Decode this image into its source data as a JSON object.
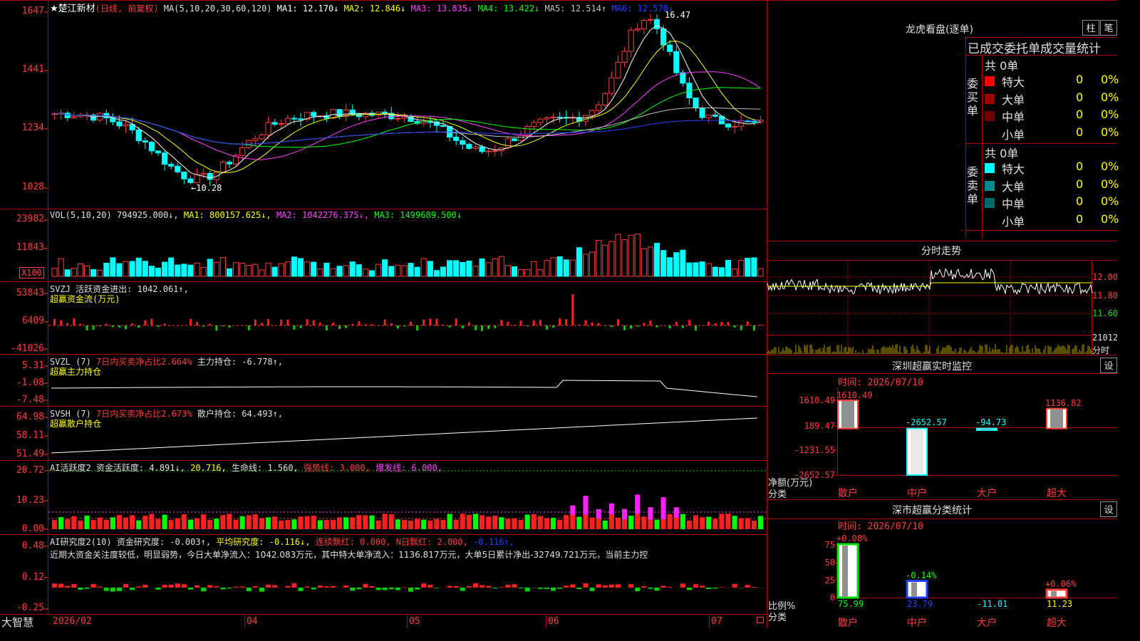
{
  "main_chart": {
    "stock_name": "★楚江新材",
    "period": "(日线, 前复权)",
    "ma_params": "MA(5,10,20,30,60,120)",
    "ma": [
      {
        "label": "MA1: 12.170↓",
        "color": "#ffffff"
      },
      {
        "label": "MA2: 12.846↓",
        "color": "#ffff00"
      },
      {
        "label": "MA3: 13.835↓",
        "color": "#ff40ff"
      },
      {
        "label": "MA4: 13.422↓",
        "color": "#00ff00"
      },
      {
        "label": "MA5: 12.514↑",
        "color": "#c0c0c0"
      },
      {
        "label": "MA6: 12.570↓",
        "color": "#2040ff"
      }
    ],
    "y_ticks": [
      "1647",
      "1441",
      "1234",
      "1028"
    ],
    "high_label": "16.47",
    "low_label": "←10.28"
  },
  "vol_panel": {
    "title": "VOL(5,10,20)",
    "value": "794925.000↓,",
    "ma1": "MA1: 800157.625↓,",
    "ma2": "MA2: 1042276.375↓,",
    "ma3": "MA3: 1499689.500↓",
    "y_ticks": [
      "23982",
      "11843"
    ],
    "unit": "X100"
  },
  "svzj_panel": {
    "title": "SVZJ",
    "label": "活跃资金进出: 1042.061↑,",
    "subtitle": "超赢资金流(万元)",
    "y_ticks": [
      "53843",
      "6409",
      "-41026"
    ]
  },
  "svzl_panel": {
    "title": "SVZL (7)",
    "ratio": "7日内买卖净占比2.664%",
    "label": "主力持仓: -6.778↑,",
    "subtitle": "超赢主力持仓",
    "y_ticks": [
      "5.31",
      "-1.08",
      "-7.48"
    ]
  },
  "svsh_panel": {
    "title": "SVSH (7)",
    "ratio": "7日内买卖净占比2.673%",
    "label": "散户持仓: 64.493↑,",
    "subtitle": "超赢散户持仓",
    "y_ticks": [
      "64.98",
      "58.11",
      "51.49"
    ]
  },
  "ai_active_panel": {
    "title": "AI活跃度2",
    "label": "资金活跃度: 4.891↓,",
    "v2": "20.716,",
    "life": "生命线: 1.560,",
    "strong": "强势线: 3.000,",
    "burst": "爆发线: 6.000,",
    "y_ticks": [
      "20.72",
      "10.23",
      "0.00"
    ]
  },
  "ai_research_panel": {
    "title": "AI研究度2(10)",
    "label": "资金研究度: -0.003↑,",
    "avg": "平均研究度: -0.116↓,",
    "red": "连续飘红: 0.000,",
    "nred": "N日飘红: 2.000,",
    "extra": "-0.116↑,",
    "comment": "近期大资金关注度较低，明显弱势，今日大单净流入：1042.083万元，其中特大单净流入：1136.817万元，大单5日累计净出-32749.721万元，当前主力控",
    "y_ticks": [
      "0.48",
      "0.12",
      "-0.25"
    ]
  },
  "x_axis": {
    "dates": [
      "2026/02",
      "04",
      "05",
      "06",
      "07"
    ],
    "brand": "大智慧"
  },
  "longhu": {
    "title": "龙虎看盘(逐单)",
    "tab_column": "柱",
    "tab_pen": "笔",
    "header": "已成交委托单成交量统计",
    "buy_label": "委买单",
    "sell_label": "委卖单",
    "buy_total": "共 0单",
    "sell_total": "共 0单",
    "buy_rows": [
      {
        "name": "特大",
        "count": "0",
        "pct": "0%",
        "color": "#ff0000"
      },
      {
        "name": "大单",
        "count": "0",
        "pct": "0%",
        "color": "#a00000"
      },
      {
        "name": "中单",
        "count": "0",
        "pct": "0%",
        "color": "#700000"
      },
      {
        "name": "小单",
        "count": "0",
        "pct": "0%",
        "color": ""
      }
    ],
    "sell_rows": [
      {
        "name": "特大",
        "count": "0",
        "pct": "0%",
        "color": "#00ffff"
      },
      {
        "name": "大单",
        "count": "0",
        "pct": "0%",
        "color": "#008c8c"
      },
      {
        "name": "中单",
        "count": "0",
        "pct": "0%",
        "color": "#006a6a"
      },
      {
        "name": "小单",
        "count": "0",
        "pct": "0%",
        "color": ""
      }
    ]
  },
  "intraday": {
    "title": "分时走势",
    "y_ticks": [
      "12.00",
      "11.80",
      "11.60"
    ],
    "vol_tick": "21012",
    "unit": "分时"
  },
  "sz_monitor": {
    "title": "深圳超赢实时监控",
    "settings": "设",
    "time_label": "时间: 2026/07/10",
    "y_ticks": [
      "1610.49",
      "189.47",
      "-1231.55",
      "-2652.57"
    ],
    "y_caption": "净额(万元)",
    "x_caption": "分类",
    "categories": [
      "散户",
      "中户",
      "大户",
      "超大"
    ],
    "chart_data": {
      "type": "bar",
      "categories": [
        "散户",
        "中户",
        "大户",
        "超大"
      ],
      "values": [
        1610.49,
        -2652.57,
        -94.73,
        1136.82
      ],
      "labels": [
        "1610.49",
        "-2652.57",
        "-94.73",
        "1136.82"
      ],
      "ylim": [
        -2652.57,
        1610.49
      ]
    }
  },
  "sz_class": {
    "title": "深市超赢分类统计",
    "settings": "设",
    "time_label": "时间: 2026/07/10",
    "y_ticks": [
      "75",
      "50",
      "25",
      "0"
    ],
    "y_caption": "比例%",
    "x_caption": "分类",
    "categories": [
      "散户",
      "中户",
      "大户",
      "超大"
    ],
    "chart_data": {
      "type": "bar",
      "categories": [
        "散户",
        "中户",
        "大户",
        "超大"
      ],
      "values": [
        75.99,
        23.79,
        -11.01,
        11.23
      ],
      "top_labels": [
        "+0.08%",
        "-0.14%",
        "",
        "+0.06%"
      ],
      "bottom_labels": [
        "75.99",
        "23.79",
        "-11.01",
        "11.23"
      ],
      "ylim": [
        0,
        75
      ]
    }
  }
}
